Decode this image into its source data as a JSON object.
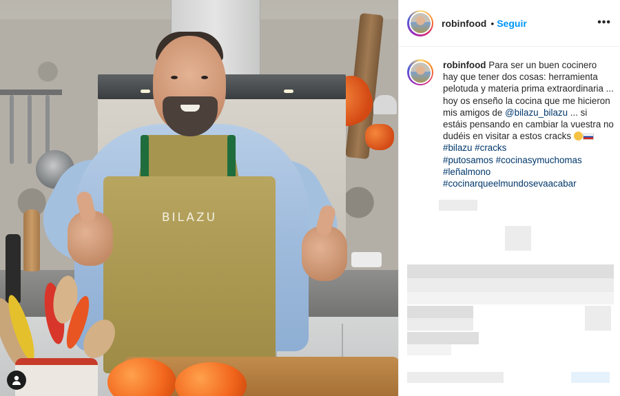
{
  "post": {
    "username": "robinfood",
    "separator": "•",
    "follow_label": "Seguir",
    "more_label": "•••",
    "caption_username": "robinfood",
    "caption_part1": " Para ser un buen cocinero hay que tener dos cosas: herramienta pelotuda y materia prima extraordinaria ... hoy os enseño la cocina que me hicieron mis amigos de ",
    "mention": "@bilazu_bilazu",
    "caption_part2": " ... si estáis pensando en cambiar la vuestra no dudéis en visitar a estos cracks ",
    "hashtags_inline": [
      "#bilazu",
      "#cracks"
    ],
    "hashtags_block": [
      "#putosamos #cocinasymuchomas",
      "#leñalmono",
      "#cocinarqueelmundosevaacabar"
    ]
  },
  "photo": {
    "apron_text": "BILAZU",
    "user_badge_icon": "person-icon"
  },
  "colors": {
    "link_blue": "#0095f6",
    "mention_blue": "#00376b",
    "text": "#262626"
  }
}
